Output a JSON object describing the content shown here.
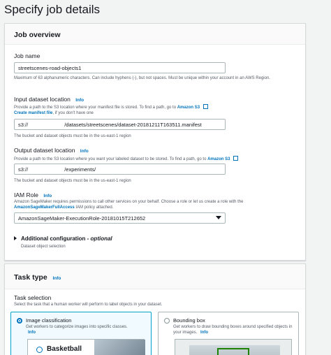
{
  "page_title": "Specify job details",
  "job_overview": {
    "title": "Job overview",
    "job_name_label": "Job name",
    "job_name_value": "streetscenes-road-objects1",
    "job_name_help": "Maximum of 63 alphanumeric characters. Can include hyphens (-), but not spaces. Must be unique within your account in an AWS Region.",
    "input_label": "Input dataset location",
    "input_info": "Info",
    "input_help_text": "Provide a path to the S3 location where your manifest file is stored. To find a path, go to",
    "input_help_link": "Amazon S3",
    "create_manifest_link": "Create manifest file",
    "create_manifest_suffix": ", if you don't have one",
    "input_prefix": "s3://",
    "input_value": "/datasets/streetscenes/dataset-20181211T163511.manifest",
    "input_footer": "The bucket and dataset objects must be in the us-east-1 region",
    "output_label": "Output dataset location",
    "output_info": "Info",
    "output_help_text": "Provide a path to the S3 location where you want your labeled dataset to be stored. To find a path, go to",
    "output_help_link": "Amazon S3",
    "output_prefix": "s3://",
    "output_value": "/experiments/",
    "output_footer": "The bucket and dataset objects must be in the us-east-1 region",
    "iam_label": "IAM Role",
    "iam_info": "Info",
    "iam_help_1": "Amazon SageMaker requires permissions to call other services on your behalf. Choose a role or let us create a role with the",
    "iam_help_link": "AmazonSageMakerFullAccess",
    "iam_help_2": "IAM policy attached.",
    "iam_value": "AmazonSageMaker-ExecutionRole-20181015T212652",
    "additional_title": "Additional configuration",
    "additional_optional": "optional",
    "additional_desc": "Dataset object selection"
  },
  "task_type": {
    "title": "Task type",
    "info": "Info",
    "selection_label": "Task selection",
    "selection_help": "Select the task that a human worker will perform to label objects in your dataset.",
    "options": [
      {
        "title": "Image classification",
        "desc": "Get workers to categorize images into specific classes.",
        "info": "Info",
        "selected": true,
        "preview_label": "Basketball"
      },
      {
        "title": "Bounding box",
        "desc": "Get workers to draw bounding boxes around specified objects in your images.",
        "info": "Info",
        "selected": false
      }
    ]
  }
}
